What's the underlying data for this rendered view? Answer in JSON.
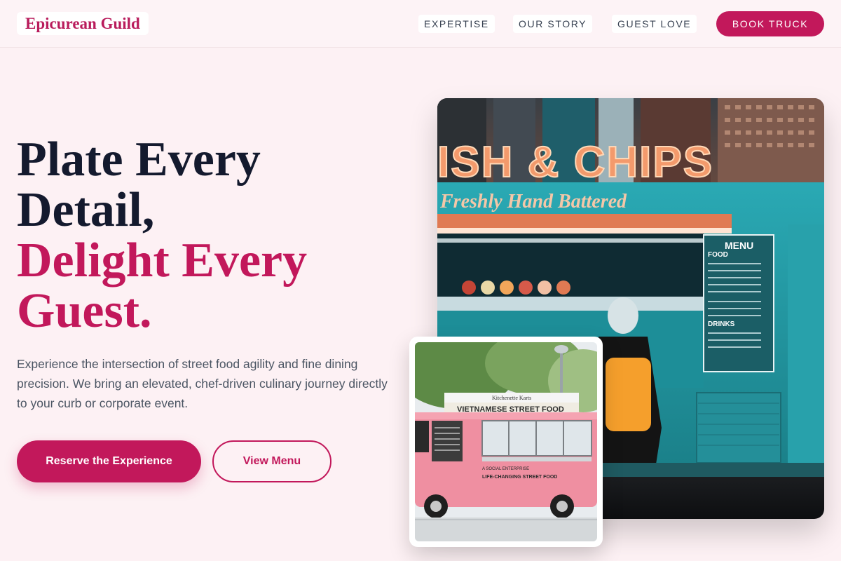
{
  "header": {
    "logo": "Epicurean Guild",
    "nav": [
      "EXPERTISE",
      "OUR STORY",
      "GUEST LOVE"
    ],
    "cta": "BOOK TRUCK"
  },
  "hero": {
    "headline_line1": "Plate Every",
    "headline_line2": "Detail,",
    "headline_line3": "Delight Every",
    "headline_line4": "Guest.",
    "subtext": "Experience the intersection of street food agility and fine dining precision. We bring an elevated, chef-driven culinary journey directly to your curb or corporate event.",
    "primary_button": "Reserve the Experience",
    "secondary_button": "View Menu"
  },
  "images": {
    "main": {
      "sign": "ISH & CHIPS",
      "script": "Freshly Hand Battered",
      "menu_title": "MENU",
      "menu_sections": [
        "FOOD",
        "DRINKS"
      ]
    },
    "overlay": {
      "top_sign": "Kitchenette Karts",
      "sign": "VIETNAMESE STREET FOOD",
      "tagline_small": "A SOCIAL ENTERPRISE",
      "tagline": "LIFE-CHANGING STREET FOOD"
    }
  },
  "colors": {
    "accent": "#c2185b",
    "headline_dark": "#141a2e",
    "background": "#fdf1f4"
  }
}
